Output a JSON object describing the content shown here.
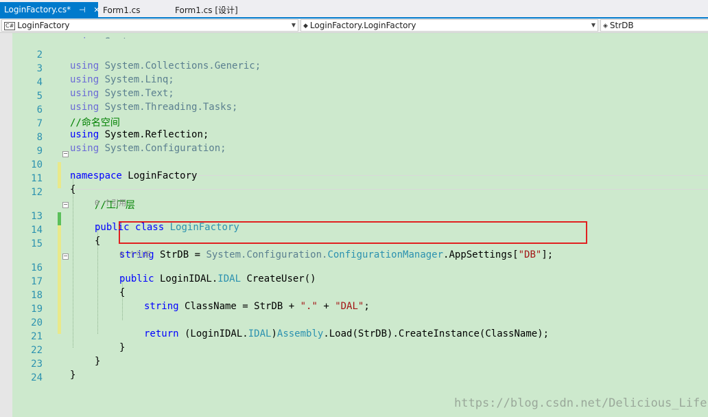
{
  "tabs": [
    {
      "label": "LoginFactory.cs*",
      "pin": "⊣",
      "close": "✕",
      "active": true
    },
    {
      "label": "Form1.cs",
      "active": false
    },
    {
      "label": "Form1.cs [设计]",
      "active": false
    }
  ],
  "nav": {
    "project": "LoginFactory",
    "type": "LoginFactory.LoginFactory",
    "member": "StrDB"
  },
  "editor": {
    "lines": [
      {
        "n": "2",
        "t": "using System.Collections.Generic;"
      },
      {
        "n": "3",
        "t": "using System.Linq;"
      },
      {
        "n": "4",
        "t": "using System.Text;"
      },
      {
        "n": "5",
        "t": "using System.Threading.Tasks;"
      },
      {
        "n": "6",
        "t": "//命名空间"
      },
      {
        "n": "7",
        "t": "using System.Reflection;"
      },
      {
        "n": "8",
        "t": "using System.Configuration;"
      },
      {
        "n": "9",
        "t": ""
      },
      {
        "n": "10",
        "t": "namespace LoginFactory"
      },
      {
        "n": "11",
        "t": "{"
      },
      {
        "n": "12",
        "t": "//工厂层"
      },
      {
        "n": "13",
        "t": "public class LoginFactory"
      },
      {
        "n": "14",
        "t": "{"
      },
      {
        "n": "15",
        "t": "string StrDB = System.Configuration.ConfigurationManager.AppSettings[\"DB\"];"
      },
      {
        "n": "16",
        "t": "public LoginIDAL.IDAL CreateUser()"
      },
      {
        "n": "17",
        "t": "{"
      },
      {
        "n": "18",
        "t": "string ClassName = StrDB + \".\" + \"DAL\";"
      },
      {
        "n": "19",
        "t": ""
      },
      {
        "n": "20",
        "t": "return (LoginIDAL.IDAL)Assembly.Load(StrDB).CreateInstance(ClassName);"
      },
      {
        "n": "21",
        "t": "}"
      },
      {
        "n": "22",
        "t": "}"
      },
      {
        "n": "23",
        "t": "}"
      },
      {
        "n": "24",
        "t": ""
      }
    ],
    "reference_hint_1": "0 个引用",
    "reference_hint_2": "0 个引用"
  },
  "watermark": "https://blog.csdn.net/Delicious_Life",
  "colors": {
    "background": "#cde9cd",
    "keyword": "#0000ff",
    "type": "#2b91af",
    "string": "#a31515",
    "comment": "#008000",
    "accent": "#007acc",
    "highlight_box": "#e02020"
  }
}
